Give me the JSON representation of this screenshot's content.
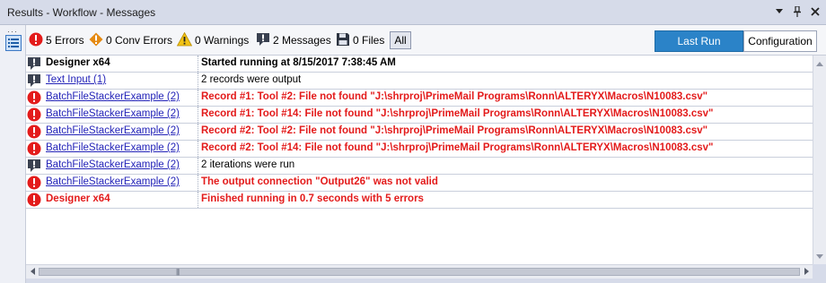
{
  "window": {
    "title": "Results - Workflow - Messages",
    "controls": [
      "dropdown-icon",
      "pin-icon",
      "close-icon"
    ]
  },
  "filters": {
    "errors": "5 Errors",
    "conv_errors": "0 Conv Errors",
    "warnings": "0 Warnings",
    "messages": "2 Messages",
    "files": "0 Files",
    "all": "All"
  },
  "buttons": {
    "last_run": "Last Run",
    "configuration": "Configuration"
  },
  "colors": {
    "error_red": "#e31b1b",
    "link_blue": "#2323b8",
    "accent_blue": "#2b83c8",
    "warning_orange": "#e58a13",
    "warning_yellow": "#f2c314"
  },
  "rows": [
    {
      "type": "message",
      "tool": "Designer x64",
      "tool_style": "bold",
      "message": "Started running  at 8/15/2017 7:38:45 AM",
      "msg_style": "bold"
    },
    {
      "type": "message",
      "tool": "Text Input (1)",
      "tool_style": "link",
      "message": "2 records were output",
      "msg_style": "normal"
    },
    {
      "type": "error",
      "tool": "BatchFileStackerExample (2)",
      "tool_style": "link",
      "message": "Record #1: Tool #2: File not found \"J:\\shrproj\\PrimeMail Programs\\Ronn\\ALTERYX\\Macros\\N10083.csv\"",
      "msg_style": "red"
    },
    {
      "type": "error",
      "tool": "BatchFileStackerExample (2)",
      "tool_style": "link",
      "message": "Record #1: Tool #14: File not found \"J:\\shrproj\\PrimeMail Programs\\Ronn\\ALTERYX\\Macros\\N10083.csv\"",
      "msg_style": "red"
    },
    {
      "type": "error",
      "tool": "BatchFileStackerExample (2)",
      "tool_style": "link",
      "message": "Record #2: Tool #2: File not found \"J:\\shrproj\\PrimeMail Programs\\Ronn\\ALTERYX\\Macros\\N10083.csv\"",
      "msg_style": "red"
    },
    {
      "type": "error",
      "tool": "BatchFileStackerExample (2)",
      "tool_style": "link",
      "message": "Record #2: Tool #14: File not found \"J:\\shrproj\\PrimeMail Programs\\Ronn\\ALTERYX\\Macros\\N10083.csv\"",
      "msg_style": "red"
    },
    {
      "type": "message",
      "tool": "BatchFileStackerExample (2)",
      "tool_style": "link",
      "message": "2 iterations were run",
      "msg_style": "normal"
    },
    {
      "type": "error",
      "tool": "BatchFileStackerExample (2)",
      "tool_style": "link",
      "message": "The output connection \"Output26\" was not valid",
      "msg_style": "red"
    },
    {
      "type": "error",
      "tool": "Designer x64",
      "tool_style": "red",
      "message": "Finished running  in 0.7 seconds with 5 errors",
      "msg_style": "red"
    }
  ]
}
